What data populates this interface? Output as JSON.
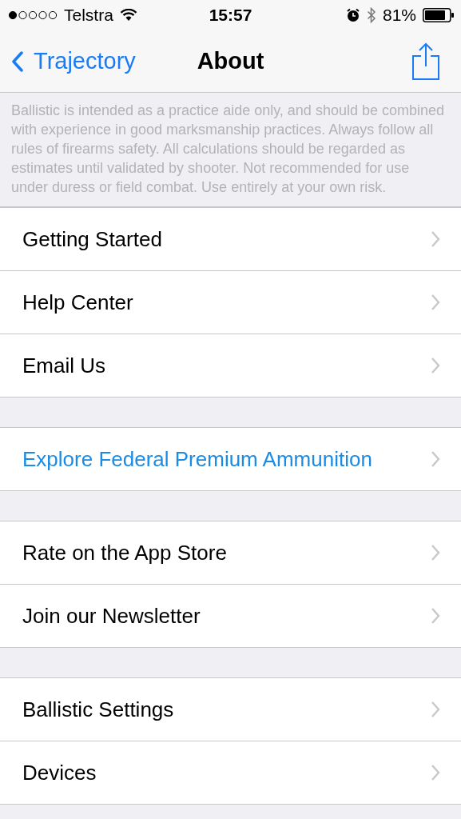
{
  "status_bar": {
    "carrier": "Telstra",
    "time": "15:57",
    "battery": "81%"
  },
  "nav": {
    "back": "Trajectory",
    "title": "About"
  },
  "disclaimer": "Ballistic is intended as a practice aide only, and should be combined with experience in good marksmanship practices. Always follow all rules of firearms safety. All calculations should be regarded as estimates until validated by shooter. Not recommended for use under duress or field combat. Use entirely at your own risk.",
  "groups": [
    [
      {
        "label": "Getting Started",
        "kind": "plain"
      },
      {
        "label": "Help Center",
        "kind": "plain"
      },
      {
        "label": "Email Us",
        "kind": "plain"
      }
    ],
    [
      {
        "label": "Explore Federal Premium Ammunition",
        "kind": "accent"
      }
    ],
    [
      {
        "label": "Rate on the App Store",
        "kind": "plain"
      },
      {
        "label": "Join our Newsletter",
        "kind": "plain"
      }
    ],
    [
      {
        "label": "Ballistic Settings",
        "kind": "plain"
      },
      {
        "label": "Devices",
        "kind": "plain"
      }
    ]
  ]
}
